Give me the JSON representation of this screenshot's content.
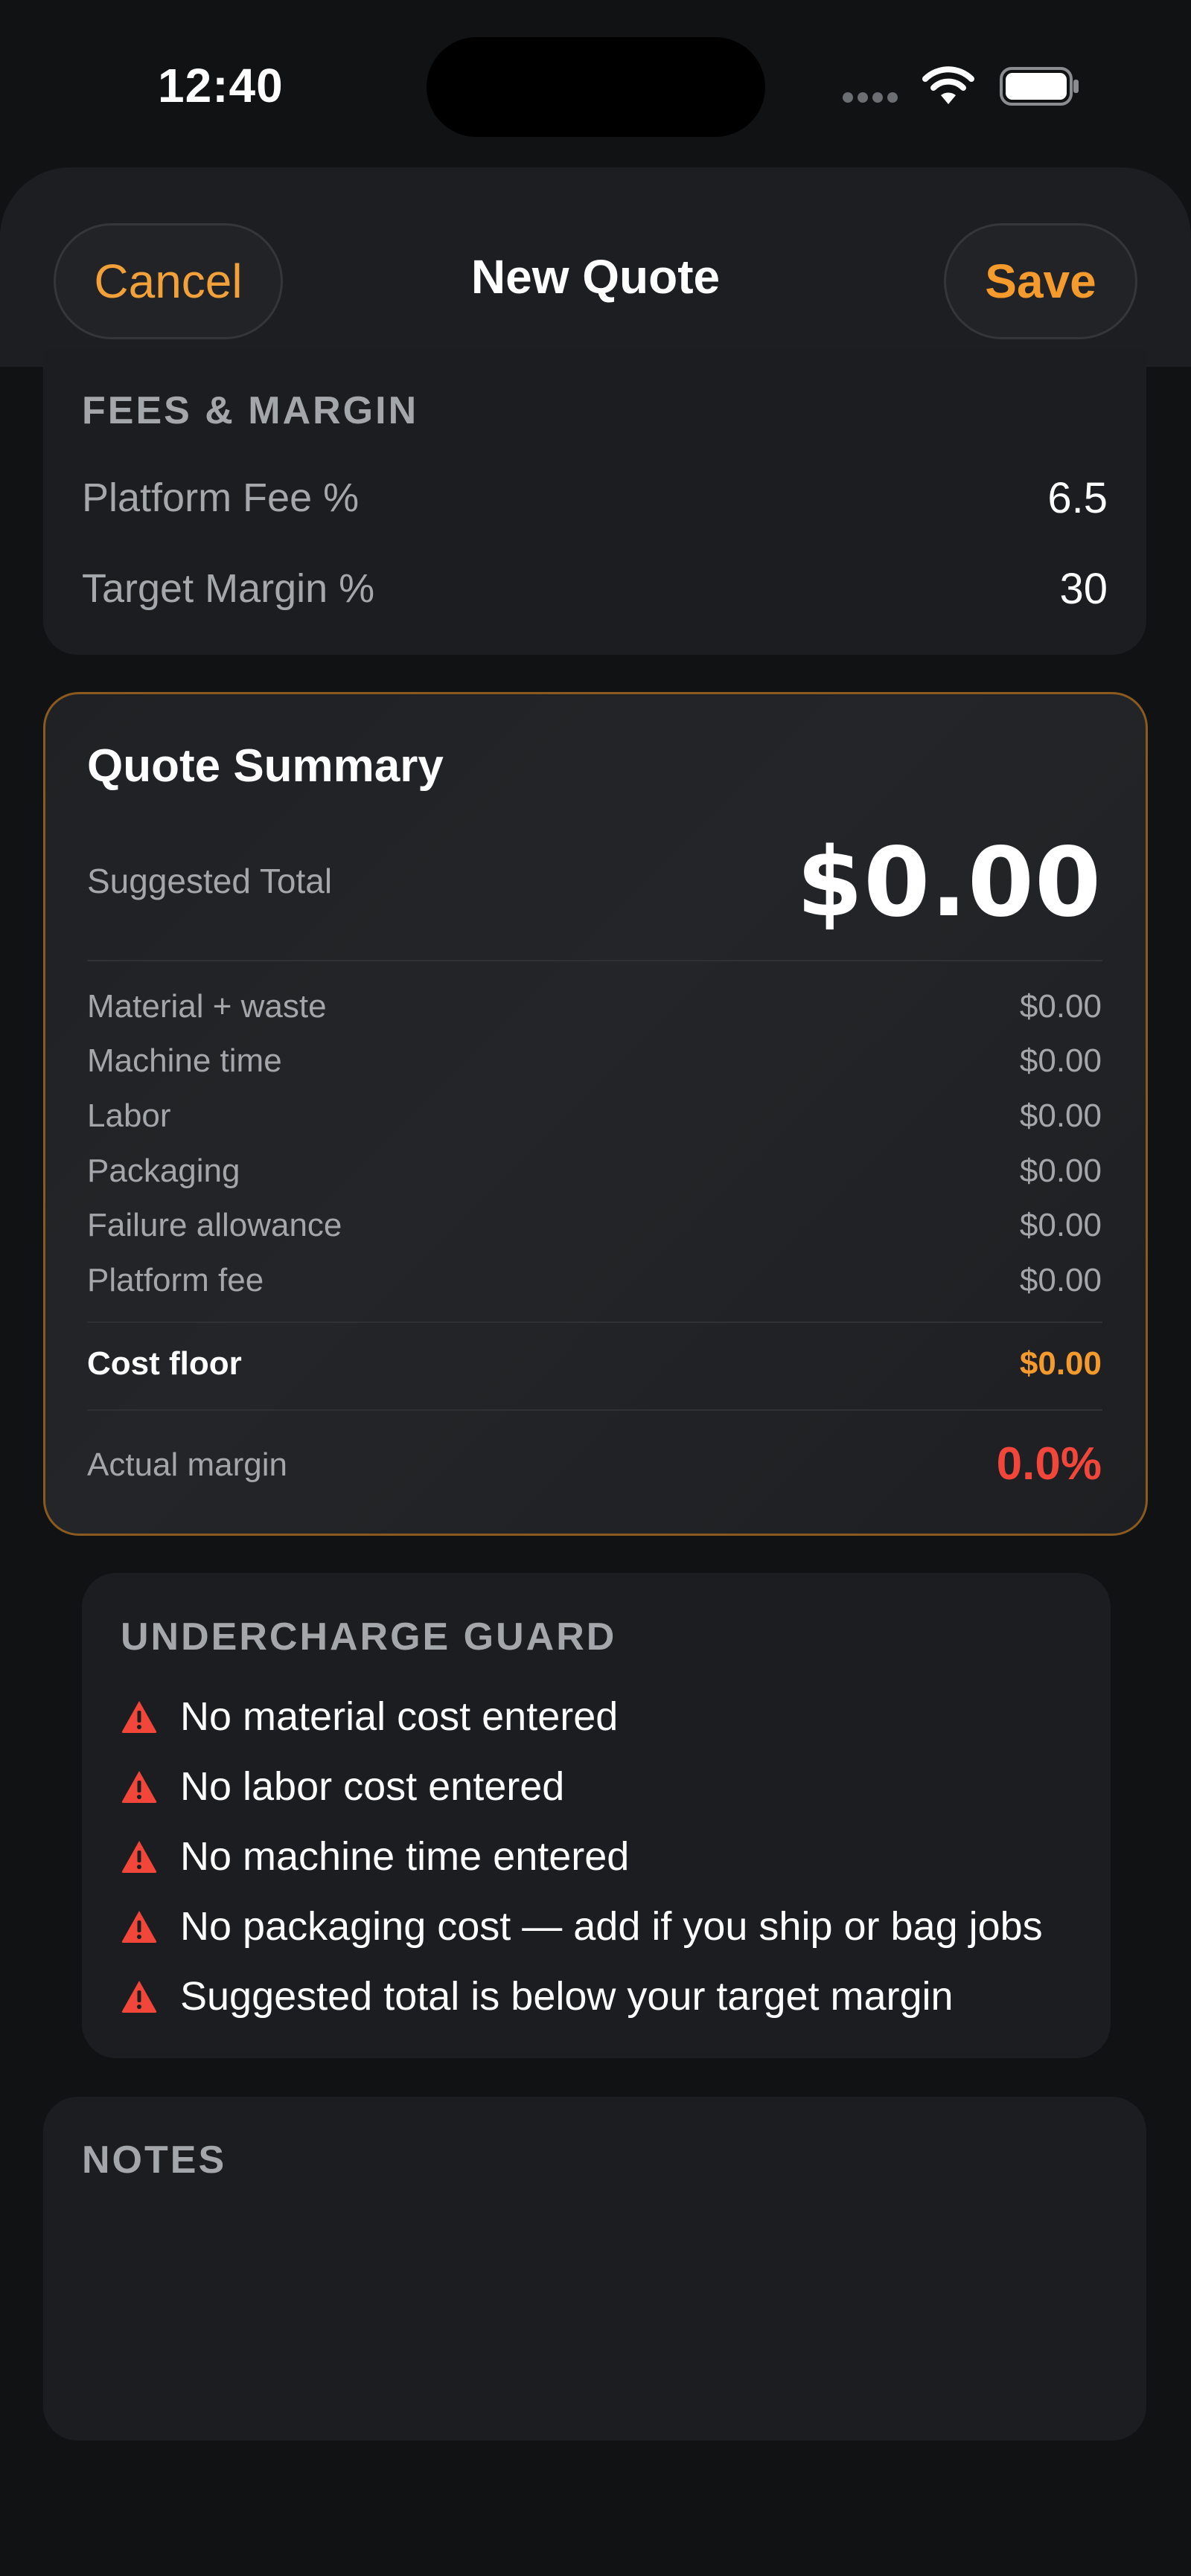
{
  "status_bar": {
    "time": "12:40"
  },
  "header": {
    "cancel_label": "Cancel",
    "title": "New Quote",
    "save_label": "Save"
  },
  "fees": {
    "title": "FEES & MARGIN",
    "rows": [
      {
        "label": "Platform Fee %",
        "value": "6.5"
      },
      {
        "label": "Target Margin %",
        "value": "30"
      }
    ]
  },
  "summary": {
    "title": "Quote Summary",
    "suggested_label": "Suggested Total",
    "suggested_value": "$0.00",
    "lines": [
      {
        "label": "Material + waste",
        "value": "$0.00"
      },
      {
        "label": "Machine time",
        "value": "$0.00"
      },
      {
        "label": "Labor",
        "value": "$0.00"
      },
      {
        "label": "Packaging",
        "value": "$0.00"
      },
      {
        "label": "Failure allowance",
        "value": "$0.00"
      },
      {
        "label": "Platform fee",
        "value": "$0.00"
      }
    ],
    "cost_floor_label": "Cost floor",
    "cost_floor_value": "$0.00",
    "actual_margin_label": "Actual margin",
    "actual_margin_value": "0.0%"
  },
  "guard": {
    "title": "UNDERCHARGE GUARD",
    "warnings": [
      "No material cost entered",
      "No labor cost entered",
      "No machine time entered",
      "No packaging cost — add if you ship or bag jobs",
      "Suggested total is below your target margin"
    ]
  },
  "notes": {
    "title": "NOTES"
  },
  "colors": {
    "accent": "#f59a2c",
    "danger": "#f2463b",
    "background": "#111214",
    "card": "#1c1d20"
  }
}
